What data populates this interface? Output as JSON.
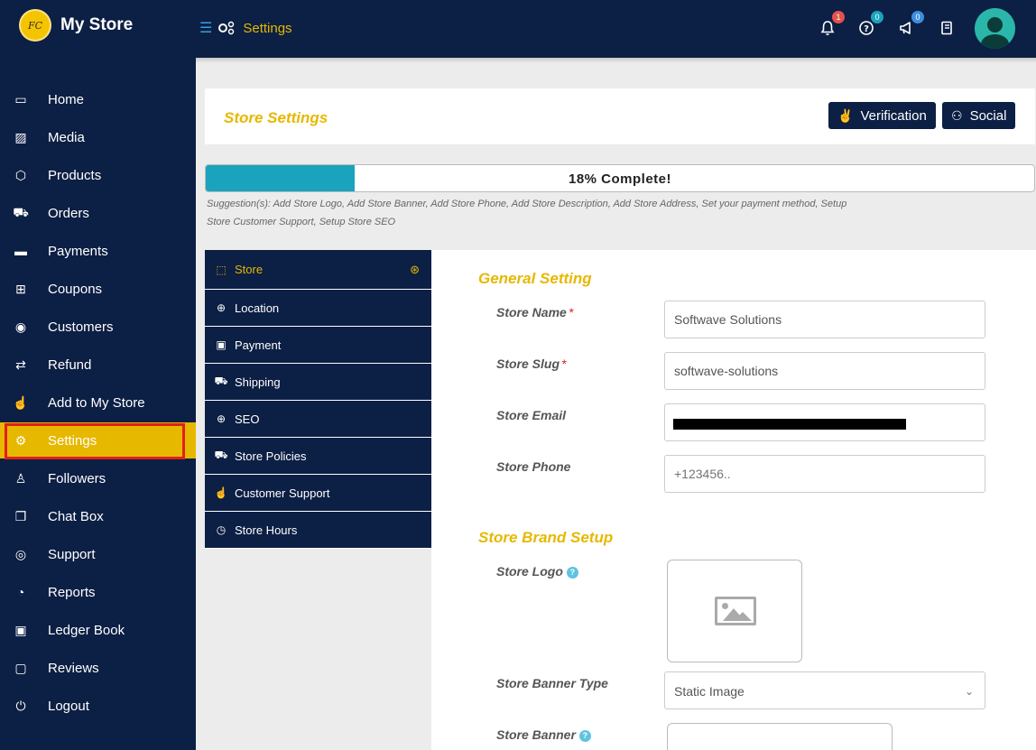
{
  "brand": {
    "name": "My Store",
    "logo_text": "FC"
  },
  "breadcrumb": {
    "label": "Settings"
  },
  "top_icons": [
    {
      "icon": "bell-icon",
      "badge": "1",
      "badge_color": "#e2534b"
    },
    {
      "icon": "help-icon",
      "badge": "0",
      "badge_color": "#1aa3bd"
    },
    {
      "icon": "megaphone-icon",
      "badge": "0",
      "badge_color": "#3d8ee0"
    },
    {
      "icon": "notebook-icon",
      "badge": ""
    }
  ],
  "sidebar": {
    "items": [
      {
        "label": "Home",
        "icon": "laptop-icon"
      },
      {
        "label": "Media",
        "icon": "image-icon"
      },
      {
        "label": "Products",
        "icon": "cube-icon"
      },
      {
        "label": "Orders",
        "icon": "cart-icon"
      },
      {
        "label": "Payments",
        "icon": "credit-card-icon"
      },
      {
        "label": "Coupons",
        "icon": "gift-icon"
      },
      {
        "label": "Customers",
        "icon": "user-circle-icon"
      },
      {
        "label": "Refund",
        "icon": "exchange-icon"
      },
      {
        "label": "Add to My Store",
        "icon": "hand-pointer-icon"
      },
      {
        "label": "Settings",
        "icon": "cogs-icon",
        "active": true
      },
      {
        "label": "Followers",
        "icon": "child-icon"
      },
      {
        "label": "Chat Box",
        "icon": "comments-icon"
      },
      {
        "label": "Support",
        "icon": "lifebuoy-icon"
      },
      {
        "label": "Reports",
        "icon": "pie-chart-icon"
      },
      {
        "label": "Ledger Book",
        "icon": "money-icon"
      },
      {
        "label": "Reviews",
        "icon": "comment-icon"
      },
      {
        "label": "Logout",
        "icon": "power-icon"
      }
    ]
  },
  "header": {
    "title": "Store Settings",
    "verification_label": "Verification",
    "social_label": "Social"
  },
  "progress": {
    "value": 0.18,
    "label": "18% Complete!",
    "suggestion": "Suggestion(s): Add Store Logo, Add Store Banner, Add Store Phone, Add Store Description, Add Store Address, Set your payment method, Setup Store Customer Support, Setup Store SEO"
  },
  "tabs": [
    {
      "label": "Store",
      "icon": "shopping-bag-icon",
      "active": true
    },
    {
      "label": "Location",
      "icon": "globe-icon"
    },
    {
      "label": "Payment",
      "icon": "money-icon"
    },
    {
      "label": "Shipping",
      "icon": "truck-icon"
    },
    {
      "label": "SEO",
      "icon": "globe-icon"
    },
    {
      "label": "Store Policies",
      "icon": "ambulance-icon"
    },
    {
      "label": "Customer Support",
      "icon": "thumbs-up-icon"
    },
    {
      "label": "Store Hours",
      "icon": "clock-icon"
    }
  ],
  "general": {
    "title": "General Setting",
    "store_name_label": "Store Name",
    "store_name_value": "Softwave Solutions",
    "store_slug_label": "Store Slug",
    "store_slug_value": "softwave-solutions",
    "store_email_label": "Store Email",
    "store_email_value": "",
    "store_phone_label": "Store Phone",
    "store_phone_placeholder": "+123456..",
    "required_mark": "*"
  },
  "brand_setup": {
    "title": "Store Brand Setup",
    "logo_label": "Store Logo",
    "banner_type_label": "Store Banner Type",
    "banner_type_value": "Static Image",
    "banner_label": "Store Banner"
  },
  "colors": {
    "navy": "#0c1f44",
    "accent": "#e7b800",
    "progress": "#1aa3bd",
    "highlight_border": "#e0201b"
  }
}
